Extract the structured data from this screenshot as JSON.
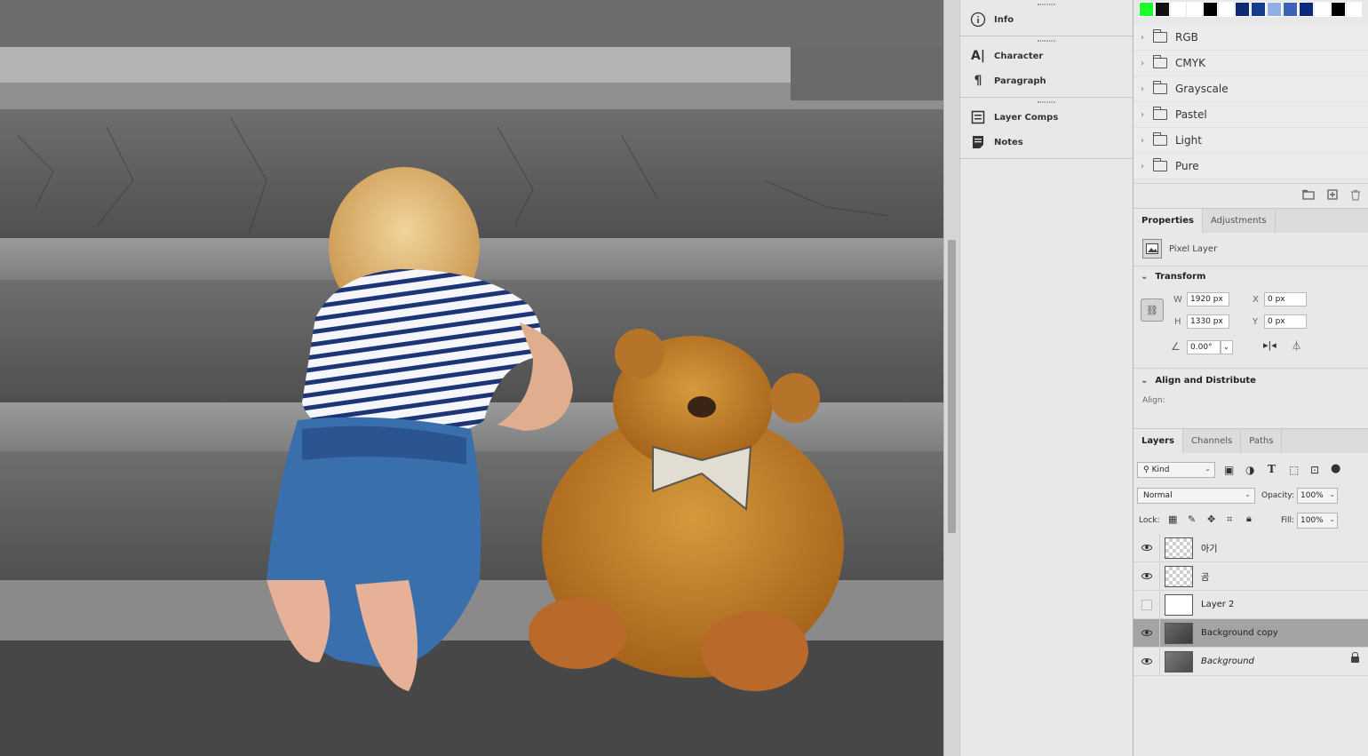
{
  "panels_mid": {
    "info": "Info",
    "character": "Character",
    "paragraph": "Paragraph",
    "layer_comps": "Layer Comps",
    "notes": "Notes"
  },
  "swatches": {
    "colors": [
      "#1aff2a",
      "#111111",
      "#ffffff",
      "#ffffff",
      "#000000",
      "#ffffff",
      "#0d2b74",
      "#163c8e",
      "#8fb0e4",
      "#3b63b8",
      "#0a2a80",
      "#ffffff",
      "#000000",
      "#ffffff"
    ],
    "groups": [
      "RGB",
      "CMYK",
      "Grayscale",
      "Pastel",
      "Light",
      "Pure"
    ]
  },
  "properties": {
    "tabs": [
      "Properties",
      "Adjustments"
    ],
    "layer_type": "Pixel Layer",
    "transform_title": "Transform",
    "w_label": "W",
    "w_value": "1920 px",
    "h_label": "H",
    "h_value": "1330 px",
    "x_label": "X",
    "x_value": "0 px",
    "y_label": "Y",
    "y_value": "0 px",
    "angle_value": "0.00°",
    "align_title": "Align and Distribute",
    "align_label": "Align:"
  },
  "layers_panel": {
    "tabs": [
      "Layers",
      "Channels",
      "Paths"
    ],
    "filter_kind": "Kind",
    "blend_mode": "Normal",
    "opacity_label": "Opacity:",
    "opacity_value": "100%",
    "lock_label": "Lock:",
    "fill_label": "Fill:",
    "fill_value": "100%",
    "layers": [
      {
        "name": "아기",
        "visible": true
      },
      {
        "name": "곰",
        "visible": true
      },
      {
        "name": "Layer 2",
        "visible": false
      },
      {
        "name": "Background copy",
        "visible": true,
        "selected": true
      },
      {
        "name": "Background",
        "visible": true,
        "locked": true
      }
    ]
  }
}
